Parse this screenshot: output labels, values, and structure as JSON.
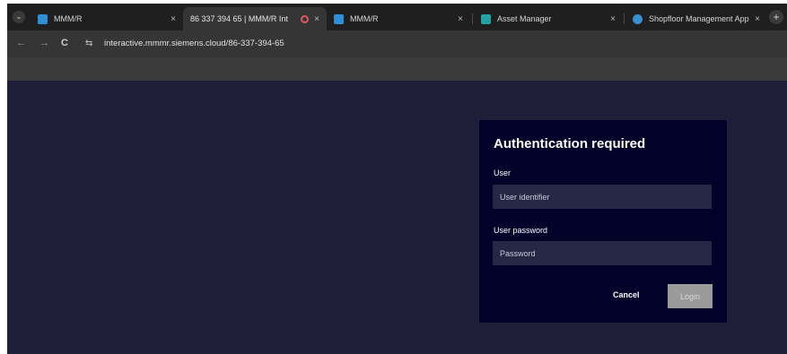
{
  "browser": {
    "tabs": [
      {
        "title": "MMM/R",
        "favicon_color": "#2d8fd5",
        "active": false
      },
      {
        "title": "86 337 394 65 | MMM/R Int",
        "favicon_color": "",
        "active": true
      },
      {
        "title": "MMM/R",
        "favicon_color": "#2d8fd5",
        "active": false
      },
      {
        "title": "Asset Manager",
        "favicon_color": "#23a3a3",
        "active": false
      },
      {
        "title": "Shopfloor Management Applic",
        "favicon_color": "#3a8fd0",
        "active": false
      }
    ],
    "close_glyph": "×",
    "new_tab_glyph": "+",
    "menu_glyph": "⌄",
    "back_glyph": "←",
    "forward_glyph": "→",
    "reload_glyph": "C",
    "site_info_glyph": "⇆",
    "url": "interactive.mmmr.siemens.cloud/86-337-394-65"
  },
  "dialog": {
    "title": "Authentication required",
    "user_label": "User",
    "user_placeholder": "User identifier",
    "user_value": "",
    "password_label": "User password",
    "password_placeholder": "Password",
    "password_value": "",
    "cancel_label": "Cancel",
    "login_label": "Login"
  },
  "colors": {
    "page_background": "#1f1e38",
    "dialog_background": "#01012a",
    "input_background": "#252845",
    "login_disabled": "#9a9a9a"
  }
}
